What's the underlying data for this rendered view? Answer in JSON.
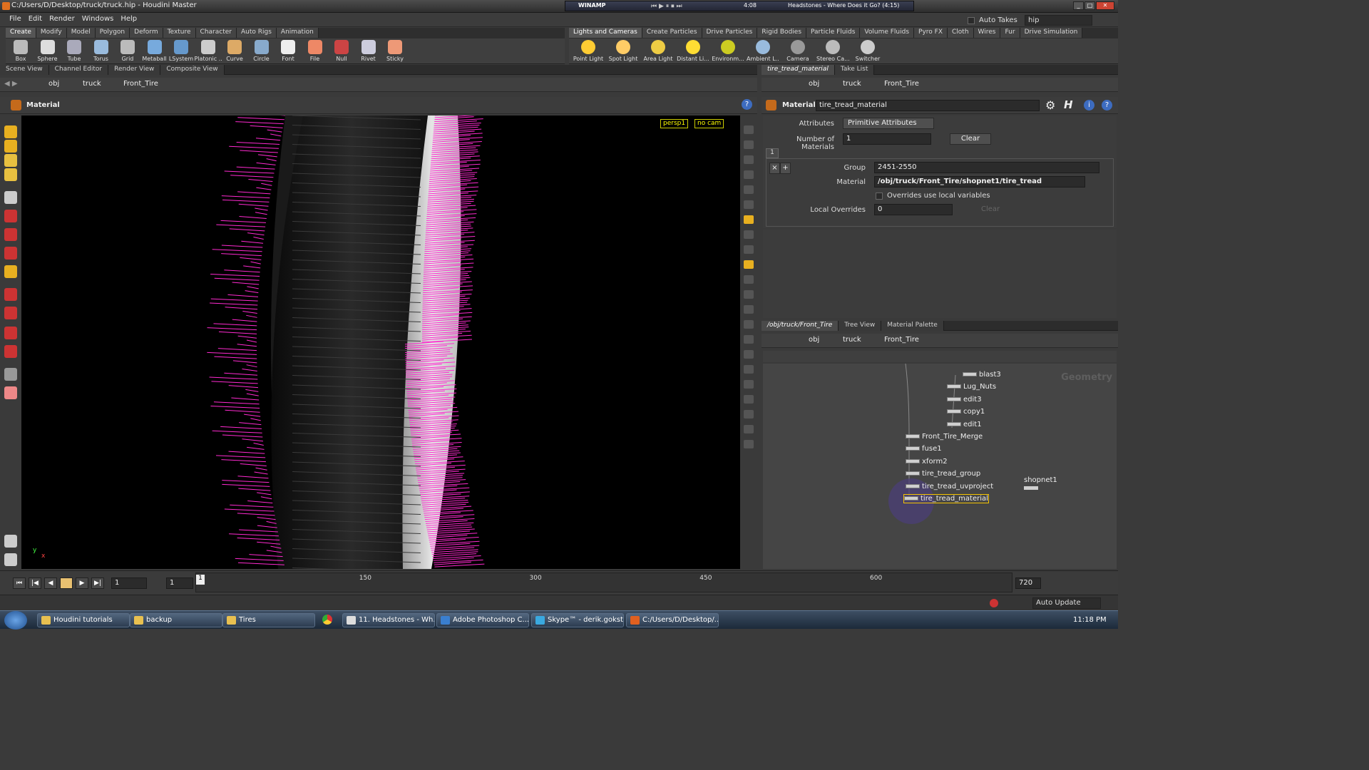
{
  "window": {
    "title": "C:/Users/D/Desktop/truck/truck.hip - Houdini Master"
  },
  "winamp": {
    "label": "WINAMP",
    "time": "4:08",
    "track": "Headstones - Where Does it Go? (4:15)"
  },
  "top_right": {
    "auto_takes": "Auto Takes",
    "take": "hip"
  },
  "menu": [
    "File",
    "Edit",
    "Render",
    "Windows",
    "Help"
  ],
  "shelf_left_tabs": [
    "Create",
    "Modify",
    "Model",
    "Polygon",
    "Deform",
    "Texture",
    "Character",
    "Auto Rigs",
    "Animation"
  ],
  "shelf_right_tabs": [
    "Lights and Cameras",
    "Create Particles",
    "Drive Particles",
    "Rigid Bodies",
    "Particle Fluids",
    "Volume Fluids",
    "Pyro FX",
    "Cloth",
    "Wires",
    "Fur",
    "Drive Simulation"
  ],
  "tools_left": [
    "Box",
    "Sphere",
    "Tube",
    "Torus",
    "Grid",
    "Metaball",
    "LSystem",
    "Platonic ...",
    "Curve",
    "Circle",
    "Font",
    "File",
    "Null",
    "Rivet",
    "Sticky"
  ],
  "tools_right": [
    "Point Light",
    "Spot Light",
    "Area Light",
    "Distant Li...",
    "Environm...",
    "Ambient L...",
    "Camera",
    "Stereo Ca...",
    "Switcher"
  ],
  "viewer_tabs": [
    "Scene View",
    "Channel Editor",
    "Render View",
    "Composite View"
  ],
  "path": {
    "root": "obj",
    "obj": "truck",
    "node": "Front_Tire"
  },
  "viewer": {
    "header": "Material",
    "camera": "persp1",
    "cam_select": "no cam"
  },
  "param_tabs": [
    "tire_tread_material",
    "Take List"
  ],
  "params": {
    "type": "Material",
    "node_name": "tire_tread_material",
    "attributes_label": "Attributes",
    "attributes_value": "Primitive Attributes",
    "num_materials_label": "Number of Materials",
    "num_materials": "1",
    "clear": "Clear",
    "tab_index": "1",
    "group_label": "Group",
    "group_value": "2451-2550",
    "material_label": "Material",
    "material_value": "/obj/truck/Front_Tire/shopnet1/tire_tread",
    "overrides_label": "Overrides use local variables",
    "local_overrides_label": "Local Overrides",
    "local_overrides": "0",
    "clear2": "Clear"
  },
  "net_tabs": [
    "/obj/truck/Front_Tire",
    "Tree View",
    "Material Palette"
  ],
  "net": {
    "context": "Geometry",
    "nodes": [
      "blast3",
      "Lug_Nuts",
      "edit3",
      "copy1",
      "edit1",
      "Front_Tire_Merge",
      "fuse1",
      "xform2",
      "tire_tread_group",
      "tire_tread_uvproject",
      "tire_tread_material"
    ],
    "shop": "shopnet1"
  },
  "timeline": {
    "frame": "1",
    "start": "1",
    "end": "720",
    "marker": "1",
    "ticks": [
      "150",
      "300",
      "450",
      "600"
    ]
  },
  "status": {
    "auto_update": "Auto Update"
  },
  "taskbar": {
    "tasks": [
      "Houdini tutorials",
      "backup",
      "Tires",
      "11. Headstones - Wh...",
      "Adobe Photoshop C...",
      "Skype™ - derik.gokst...",
      "C:/Users/D/Desktop/..."
    ],
    "clock": "11:18 PM"
  }
}
